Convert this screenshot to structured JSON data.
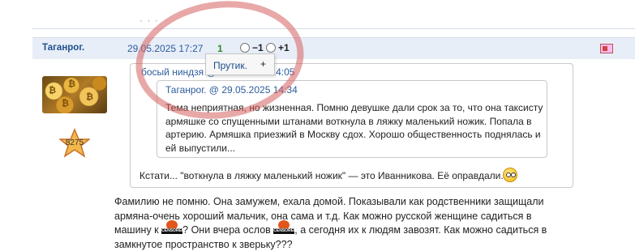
{
  "top_ellipsis": "· · ·",
  "post": {
    "author": "Таганрог.",
    "date": "29.05.2025 17:27",
    "score": "1",
    "vote_minus": "−1",
    "vote_plus": "+1"
  },
  "popup": {
    "label": "Прутик.",
    "plus": "+"
  },
  "user": {
    "star_count": "8275"
  },
  "outer_quote": {
    "header": "босый ниндзя @ 29.05.2025 14:05",
    "reply": "Кстати... \"воткнула в ляжку маленький ножик\" — это Иванникова. Её оправдали."
  },
  "inner_quote": {
    "header": "Таганрог. @ 29.05.2025 14:34",
    "text": "Тема неприятная, но жизненная. Помню девушке дали срок за то, что она таксисту армяшке со спущенными штанами воткнула в ляжку маленький ножик. Попала в артерию. Армяшка приезжий в Москву сдох. Хорошо общественность поднялась и ей выпустили..."
  },
  "body": {
    "line1": "Фамилию не помню. Она замужем, ехала домой. Показывали как родственники защищали",
    "line2": "армяна-очень хороший мальчик, она сама и т.д. Как можно русской женщине садиться в",
    "line3a": "машину к",
    "line3b": "? Они вчера ослов",
    "line3c": ", а сегодня их к людям завозят. Как можно садиться в",
    "line4": "замкнутое пространство к зверьку???",
    "censored_label": "CENSORED"
  },
  "colors": {
    "header_bg": "#e8eef8",
    "link": "#2d5c9e",
    "score_green": "#2a8a2a",
    "highlight": "#d66060"
  }
}
